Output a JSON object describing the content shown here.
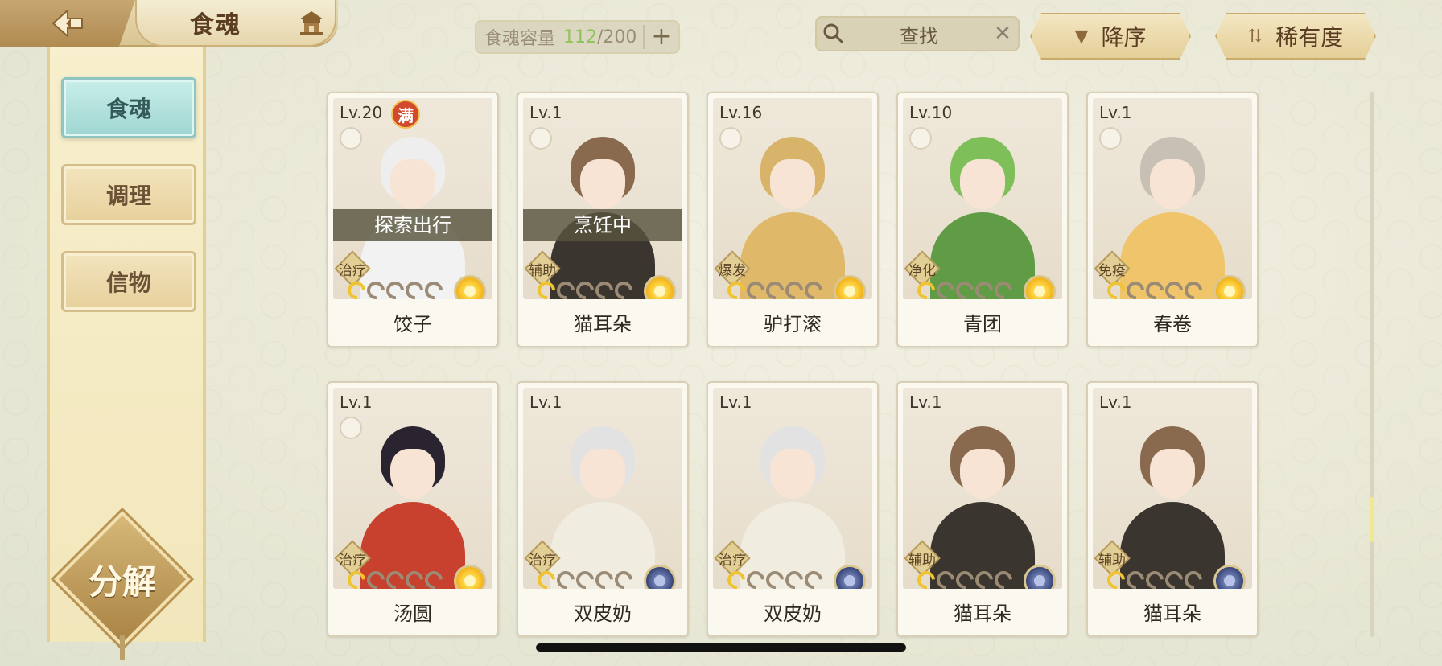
{
  "header": {
    "title": "食魂",
    "capacity_label": "食魂容量",
    "capacity_current": "112",
    "capacity_max": "/200",
    "plus": "+",
    "search_text": "查找",
    "search_clear": "✕",
    "sort_order": "降序",
    "sort_by": "稀有度"
  },
  "sidebar": {
    "tabs": [
      {
        "label": "食魂",
        "active": true
      },
      {
        "label": "调理",
        "active": false
      },
      {
        "label": "信物",
        "active": false
      }
    ],
    "decompose": "分解"
  },
  "cards": [
    {
      "level": "Lv.20",
      "full": "满",
      "status": "探索出行",
      "role": "治疗",
      "stars": 1,
      "element": "gold",
      "name": "饺子",
      "hair": "#eeeeee",
      "cloth": "#f2f2f2"
    },
    {
      "level": "Lv.1",
      "status": "烹饪中",
      "role": "辅助",
      "stars": 1,
      "element": "gold",
      "name": "猫耳朵",
      "hair": "#8a6a4e",
      "cloth": "#3b3530"
    },
    {
      "level": "Lv.16",
      "role": "爆发",
      "stars": 1,
      "element": "gold",
      "name": "驴打滚",
      "hair": "#d8b46a",
      "cloth": "#e0b86a"
    },
    {
      "level": "Lv.10",
      "role": "净化",
      "stars": 1,
      "element": "gold",
      "name": "青团",
      "hair": "#7fbf5a",
      "cloth": "#5f9c45"
    },
    {
      "level": "Lv.1",
      "role": "免疫",
      "stars": 1,
      "element": "gold",
      "name": "春卷",
      "hair": "#c8c0b4",
      "cloth": "#f0c46a"
    },
    {
      "level": "Lv.1",
      "role": "治疗",
      "stars": 1,
      "element": "gold",
      "name": "汤圆",
      "hair": "#2a2430",
      "cloth": "#c8402e"
    },
    {
      "level": "Lv.1",
      "role": "治疗",
      "stars": 1,
      "element": "blue",
      "name": "双皮奶",
      "hair": "#e2e2e2",
      "cloth": "#f0ece0"
    },
    {
      "level": "Lv.1",
      "role": "治疗",
      "stars": 1,
      "element": "blue",
      "name": "双皮奶",
      "hair": "#e2e2e2",
      "cloth": "#f0ece0"
    },
    {
      "level": "Lv.1",
      "role": "辅助",
      "stars": 1,
      "element": "blue",
      "name": "猫耳朵",
      "hair": "#8a6a4e",
      "cloth": "#3b3530"
    },
    {
      "level": "Lv.1",
      "role": "辅助",
      "stars": 1,
      "element": "blue",
      "name": "猫耳朵",
      "hair": "#8a6a4e",
      "cloth": "#3b3530"
    }
  ],
  "colors": {
    "accent_green": "#8fc35b",
    "active_tab": "#9fd6d2"
  }
}
